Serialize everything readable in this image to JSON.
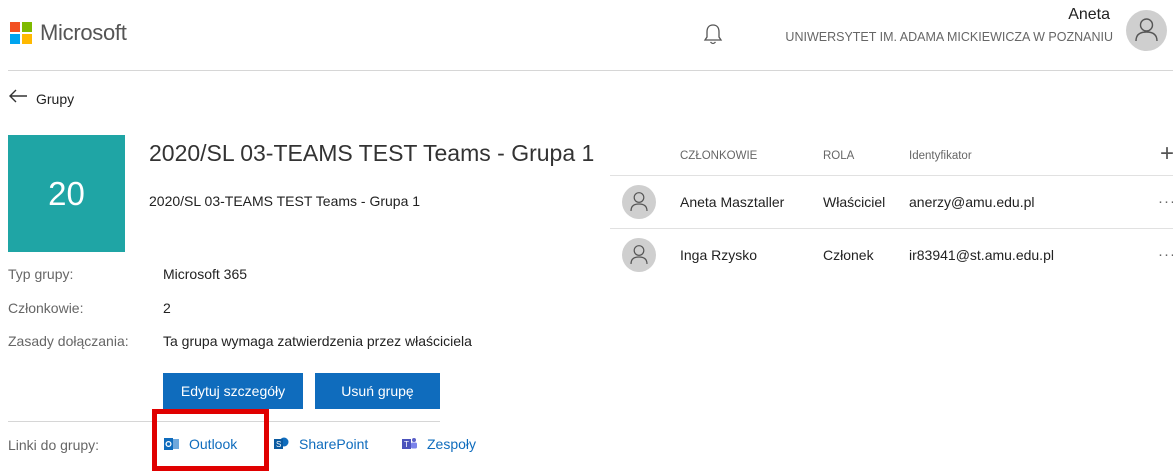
{
  "header": {
    "brand": "Microsoft",
    "user_name": "Aneta",
    "organization": "UNIWERSYTET IM. ADAMA MICKIEWICZA W POZNANIU"
  },
  "nav": {
    "back_label": "Grupy"
  },
  "group": {
    "tile_text": "20",
    "tile_color": "#1fa5a5",
    "title": "2020/SL 03-TEAMS TEST Teams - Grupa 1",
    "subtitle": "2020/SL 03-TEAMS TEST Teams - Grupa 1",
    "props": {
      "type_label": "Typ grupy:",
      "type_value": "Microsoft 365",
      "members_label": "Członkowie:",
      "members_value": "2",
      "rules_label": "Zasady dołączania:",
      "rules_value": "Ta grupa wymaga zatwierdzenia przez właściciela"
    },
    "buttons": {
      "edit": "Edytuj szczegóły",
      "delete": "Usuń grupę"
    },
    "links": {
      "label": "Linki do grupy:",
      "outlook": "Outlook",
      "sharepoint": "SharePoint",
      "teams": "Zespoły"
    }
  },
  "members_table": {
    "columns": {
      "members": "CZŁONKOWIE",
      "role": "ROLA",
      "id": "Identyfikator"
    },
    "rows": [
      {
        "name": "Aneta Masztaller",
        "role": "Właściciel",
        "id": "anerzy@amu.edu.pl"
      },
      {
        "name": "Inga Rzysko",
        "role": "Członek",
        "id": "ir83941@st.amu.edu.pl"
      }
    ]
  },
  "colors": {
    "accent": "#0f6cbd",
    "highlight": "#e00000"
  }
}
